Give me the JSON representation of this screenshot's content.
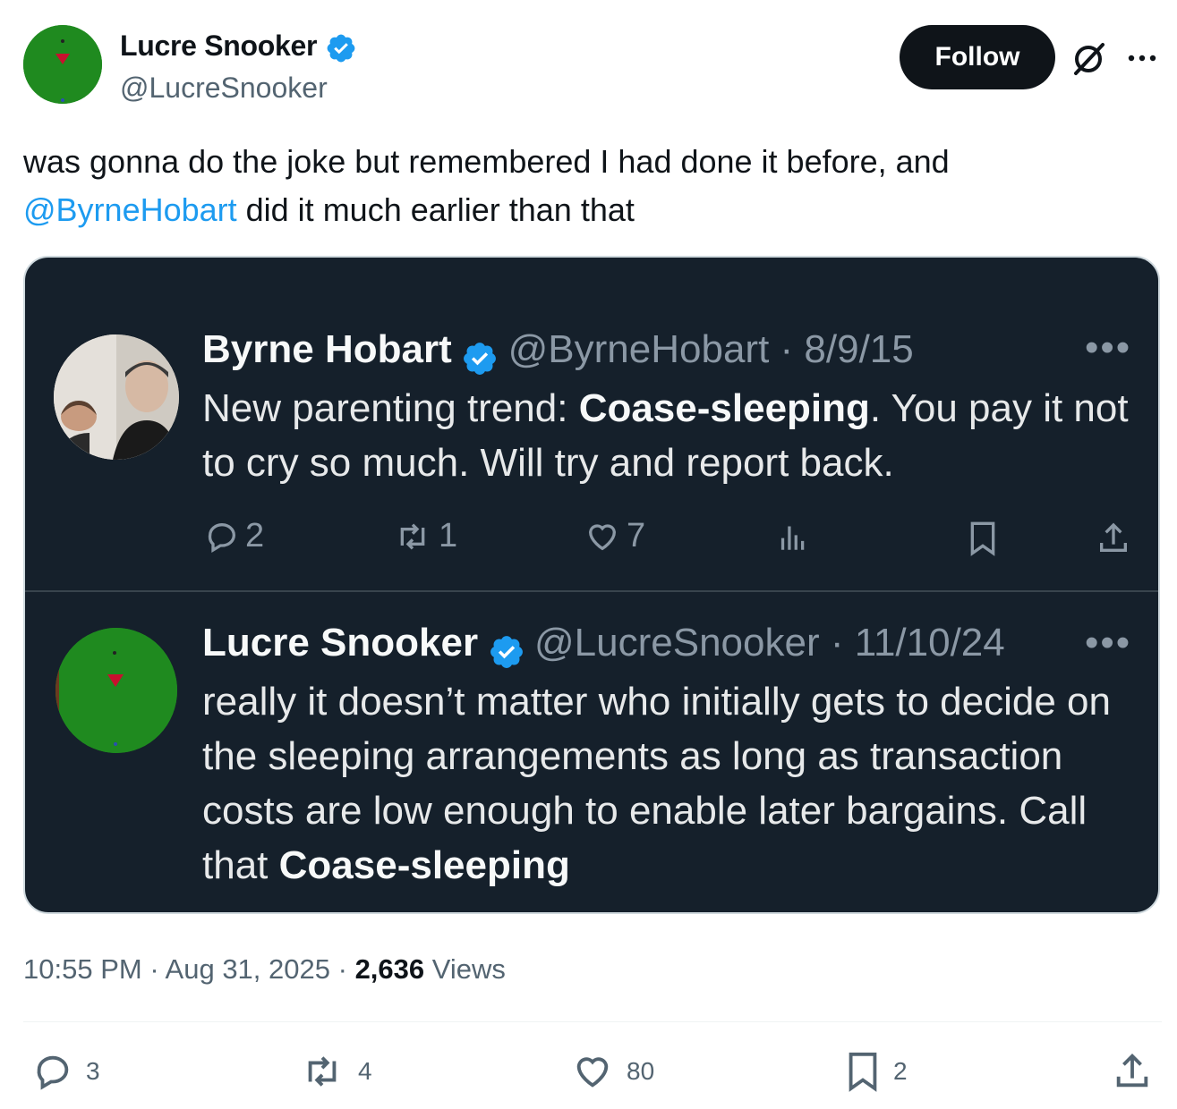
{
  "author": {
    "name": "Lucre Snooker",
    "handle": "@LucreSnooker",
    "follow_label": "Follow"
  },
  "tweet": {
    "text_part1": "was gonna do the joke but remembered I had done it before, and",
    "mention": "@ByrneHobart",
    "text_part2": " did it much earlier than that"
  },
  "embedded": {
    "quote1": {
      "name": "Byrne Hobart",
      "handle": "@ByrneHobart",
      "date": "8/9/15",
      "text_a": "New parenting trend: ",
      "text_bold": "Coase-sleeping",
      "text_b": ". You pay it not to cry so much. Will try and report back.",
      "replies": "2",
      "reposts": "1",
      "likes": "7"
    },
    "quote2": {
      "name": "Lucre Snooker",
      "handle": "@LucreSnooker",
      "date": "11/10/24",
      "text_a": "really it doesn’t matter who initially gets to decide on the sleeping arrangements as long as transaction costs are low enough to enable later bargains. Call that ",
      "text_bold": "Coase-sleeping"
    }
  },
  "meta": {
    "time": "10:55 PM",
    "date": "Aug 31, 2025",
    "views_count": "2,636",
    "views_label": "Views"
  },
  "actions": {
    "replies": "3",
    "reposts": "4",
    "likes": "80",
    "bookmarks": "2"
  },
  "colors": {
    "accent": "#1d9bf0",
    "card_bg": "#15202b",
    "snooker_green": "#1f8a1f"
  }
}
